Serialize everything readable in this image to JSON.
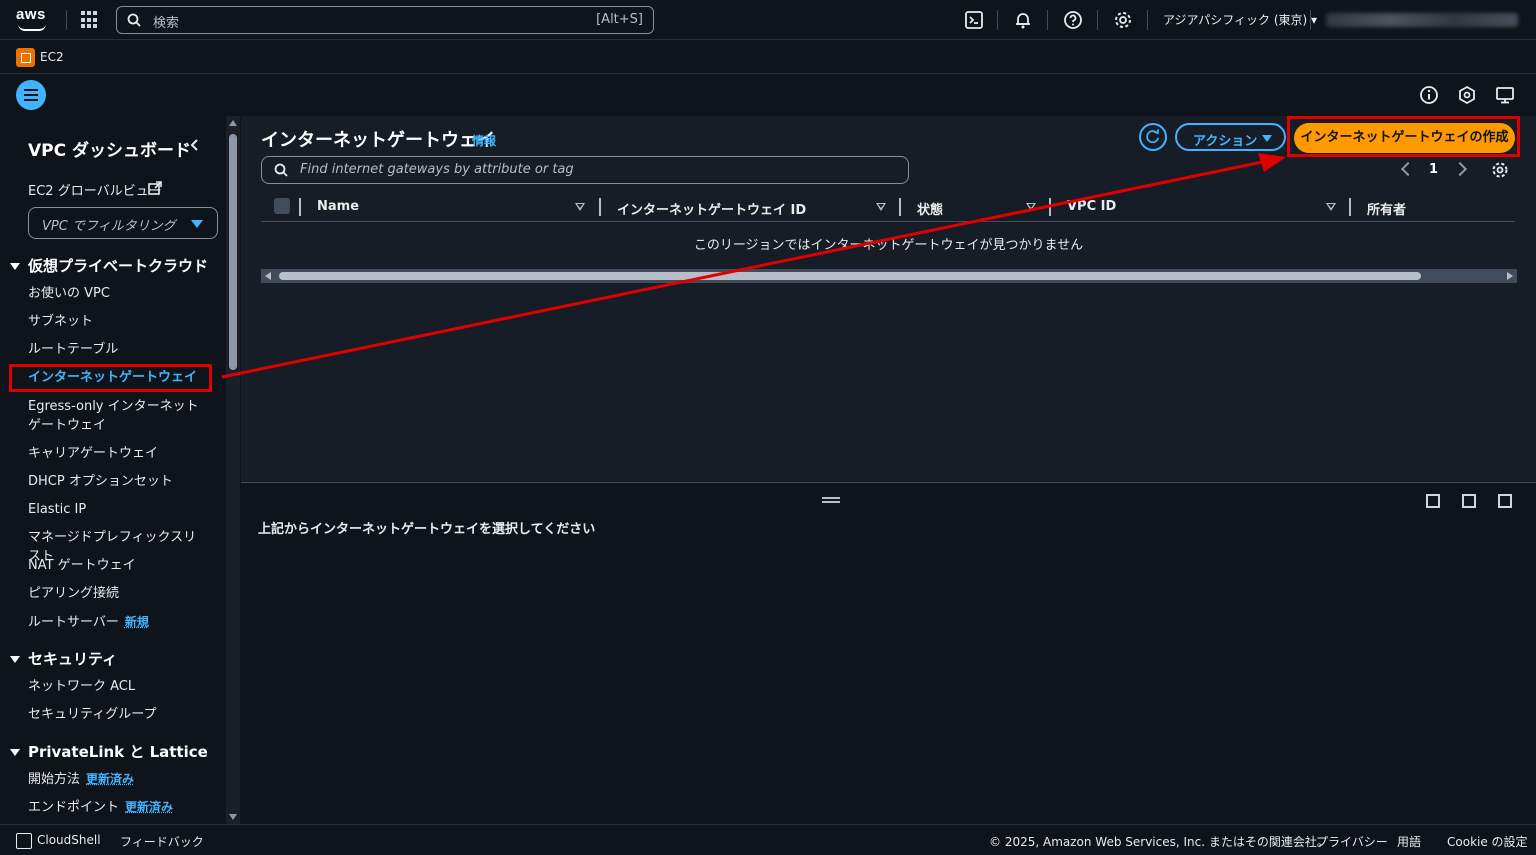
{
  "topnav": {
    "logo_text": "aws",
    "search_placeholder": "検索",
    "search_shortcut": "[Alt+S]",
    "region": "アジアパシフィック (東京) ▾"
  },
  "service": {
    "label": "EC2"
  },
  "sidenav": {
    "title": "VPC ダッシュボード",
    "ec2_global_view": "EC2 グローバルビュー",
    "filter_select": "VPC でフィルタリング",
    "sections": [
      {
        "title": "仮想プライベートクラウド",
        "items": [
          {
            "label": "お使いの VPC"
          },
          {
            "label": "サブネット"
          },
          {
            "label": "ルートテーブル"
          },
          {
            "label": "インターネットゲートウェイ"
          },
          {
            "label": "Egress-only インターネットゲートウェイ"
          },
          {
            "label": "キャリアゲートウェイ"
          },
          {
            "label": "DHCP オプションセット"
          },
          {
            "label": "Elastic IP"
          },
          {
            "label": "マネージドプレフィックスリスト"
          },
          {
            "label": "NAT ゲートウェイ"
          },
          {
            "label": "ピアリング接続"
          },
          {
            "label": "ルートサーバー",
            "badge": "新規"
          }
        ]
      },
      {
        "title": "セキュリティ",
        "items": [
          {
            "label": "ネットワーク ACL"
          },
          {
            "label": "セキュリティグループ"
          }
        ]
      },
      {
        "title": "PrivateLink と Lattice",
        "items": [
          {
            "label": "開始方法",
            "badge": "更新済み"
          },
          {
            "label": "エンドポイント",
            "badge": "更新済み"
          }
        ]
      }
    ]
  },
  "main": {
    "title": "インターネットゲートウェイ",
    "info_link": "情報",
    "actions_button": "アクション",
    "create_button": "インターネットゲートウェイの作成",
    "filter_placeholder": "Find internet gateways by attribute or tag",
    "page_number": "1",
    "columns": [
      "Name",
      "インターネットゲートウェイ ID",
      "状態",
      "VPC ID",
      "所有者"
    ],
    "empty_message": "このリージョンではインターネットゲートウェイが見つかりません"
  },
  "split_panel": {
    "message": "上記からインターネットゲートウェイを選択してください"
  },
  "footer": {
    "cloudshell": "CloudShell",
    "feedback": "フィードバック",
    "copyright": "© 2025, Amazon Web Services, Inc. またはその関連会社。",
    "privacy": "プライバシー",
    "terms": "用語",
    "cookie": "Cookie の設定"
  },
  "colors": {
    "accent": "#42b4ff",
    "primary_button": "#ff9900",
    "annotation": "#e00000"
  }
}
